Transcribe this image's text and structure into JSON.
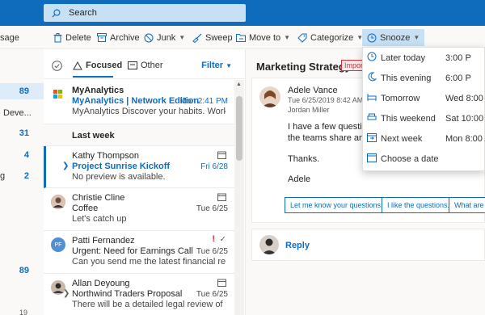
{
  "search": {
    "placeholder": "Search"
  },
  "toolbar": {
    "left_text": "sage",
    "delete": "Delete",
    "archive": "Archive",
    "junk": "Junk",
    "sweep": "Sweep",
    "move_to": "Move to",
    "categorize": "Categorize",
    "snooze": "Snooze"
  },
  "leftnav": {
    "items": [
      {
        "label": "",
        "count": "89"
      },
      {
        "label": "Deve...",
        "count": ""
      },
      {
        "label": "",
        "count": "31"
      },
      {
        "label": "",
        "count": "4"
      },
      {
        "label": "g",
        "count": "2"
      },
      {
        "label": "",
        "count": "89"
      },
      {
        "label": "",
        "count": "19"
      }
    ]
  },
  "list": {
    "tab_focused": "Focused",
    "tab_other": "Other",
    "filter": "Filter",
    "group_last_week": "Last week",
    "messages": [
      {
        "sender": "MyAnalytics",
        "subject": "MyAnalytics | Network Edition",
        "time": "Mon 2:41 PM",
        "preview": "MyAnalytics Discover your habits. Work smarte..."
      },
      {
        "sender": "Kathy Thompson",
        "subject": "Project Sunrise Kickoff",
        "time": "Fri 6/28",
        "preview": "No preview is available."
      },
      {
        "sender": "Christie Cline",
        "subject": "Coffee",
        "time": "Tue 6/25",
        "preview": "Let's catch up"
      },
      {
        "sender": "Patti Fernandez",
        "subject": "Urgent: Need for Earnings Call",
        "time": "Tue 6/25",
        "preview": "Can you send me the latest financial results by...",
        "initials": "PF"
      },
      {
        "sender": "Allan Deyoung",
        "subject": "Northwind Traders Proposal",
        "time": "Tue 6/25",
        "preview": "There will be a detailed legal review of the Nor..."
      }
    ]
  },
  "reading": {
    "subject": "Marketing Strategy",
    "badge": "Impor",
    "from": "Adele Vance",
    "date": "Tue 6/25/2019 8:42 AM",
    "to": "Jordan Miller",
    "body1": "I have a few questions",
    "body2": "the teams share and g",
    "thanks": "Thanks.",
    "sign": "Adele",
    "quick1": "Let me know your questions.",
    "quick2": "I like the questions.",
    "quick3": "What are th",
    "reply": "Reply"
  },
  "snooze_menu": [
    {
      "label": "Later today",
      "time": "3:00 P",
      "icon": "clock-icon"
    },
    {
      "label": "This evening",
      "time": "6:00 P",
      "icon": "moon-icon"
    },
    {
      "label": "Tomorrow",
      "time": "Wed 8:00 A",
      "icon": "bed-icon"
    },
    {
      "label": "This weekend",
      "time": "Sat 10:00 A",
      "icon": "couch-icon"
    },
    {
      "label": "Next week",
      "time": "Mon 8:00 A",
      "icon": "calendar-next-icon"
    },
    {
      "label": "Choose a date",
      "time": "",
      "icon": "calendar-icon"
    }
  ],
  "colors": {
    "accent": "#0f6cbd",
    "urgent": "#d13438"
  }
}
